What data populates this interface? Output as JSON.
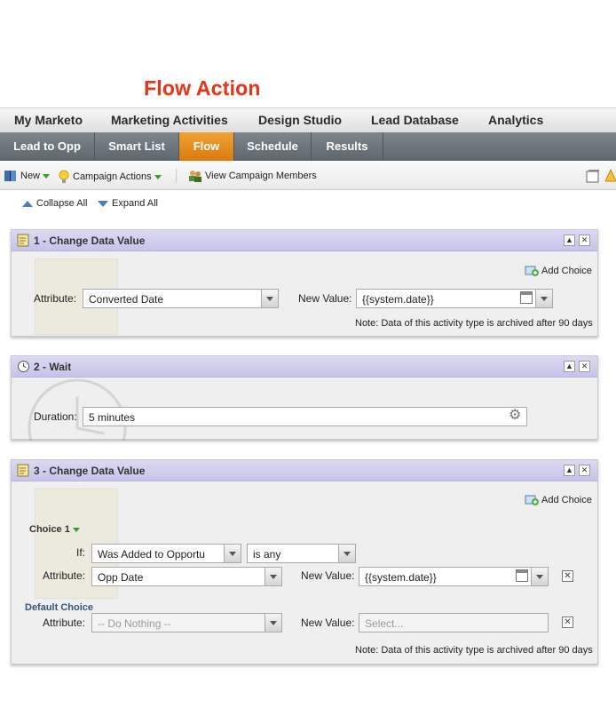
{
  "page_title": "Flow Action",
  "top_nav": [
    "My Marketo",
    "Marketing Activities",
    "Design Studio",
    "Lead Database",
    "Analytics"
  ],
  "sub_tabs": [
    "Lead to Opp",
    "Smart List",
    "Flow",
    "Schedule",
    "Results"
  ],
  "active_tab": "Flow",
  "toolbar": {
    "new_label": "New",
    "campaign_actions_label": "Campaign Actions",
    "view_members_label": "View Campaign Members"
  },
  "collapse_all": "Collapse All",
  "expand_all": "Expand All",
  "steps": [
    {
      "title": "1 - Change Data Value",
      "add_choice": "Add Choice",
      "attribute_label": "Attribute:",
      "attribute_value": "Converted Date",
      "new_value_label": "New Value:",
      "new_value": "{{system.date}}",
      "note": "Note: Data of this activity type is archived after 90 days"
    },
    {
      "title": "2 - Wait",
      "duration_label": "Duration:",
      "duration_value": "5 minutes"
    },
    {
      "title": "3 - Change Data Value",
      "add_choice": "Add Choice",
      "choice_label": "Choice 1",
      "if_label": "If:",
      "if_field": "Was Added to Opportu",
      "if_operator": "is any",
      "attribute_label": "Attribute:",
      "attribute_value": "Opp Date",
      "new_value_label": "New Value:",
      "new_value": "{{system.date}}",
      "default_choice_label": "Default Choice",
      "default_attribute_label": "Attribute:",
      "default_attribute_value": "-- Do Nothing --",
      "default_new_value_label": "New Value:",
      "default_new_value_placeholder": "Select...",
      "note": "Note: Data of this activity type is archived after 90 days"
    }
  ],
  "colors": {
    "title_red": "#e2371e",
    "active_tab_orange": "#e88a1c",
    "card_header_lavender": "#cfcdef",
    "default_choice_blue": "#34557a"
  }
}
